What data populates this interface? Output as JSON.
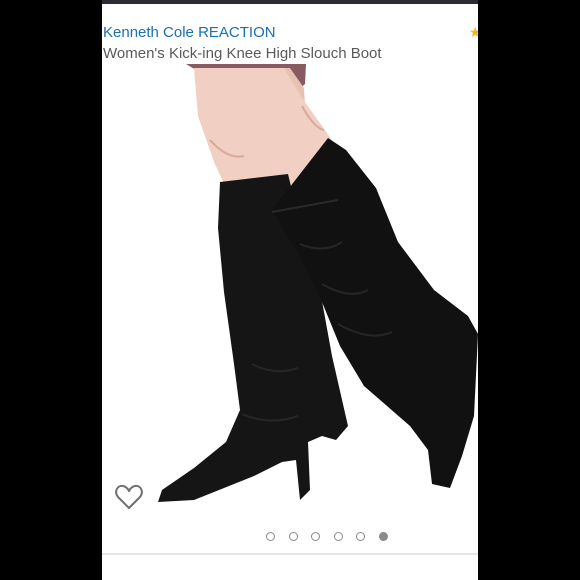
{
  "product": {
    "brand": "Kenneth Cole REACTION",
    "title": "Women's Kick-ing Knee High Slouch Boot"
  },
  "rating": {
    "star_icon": "star-icon"
  },
  "image": {
    "subject": "black suede knee high slouch boots"
  },
  "favorite": {
    "icon": "heart-outline-icon"
  },
  "carousel": {
    "count": 6,
    "active_index": 5
  },
  "colors": {
    "brand_link": "#1a6fb5",
    "star": "#f3b51c",
    "title_text": "#5a5a5a"
  }
}
